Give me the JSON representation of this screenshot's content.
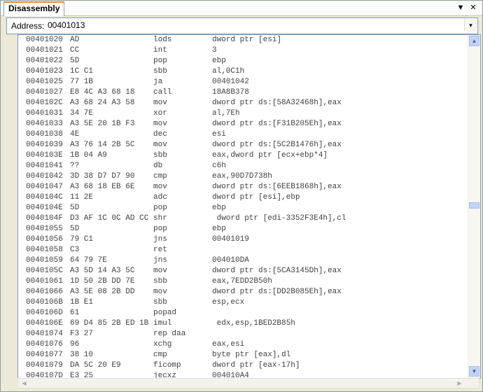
{
  "window": {
    "tab_title": "Disassembly",
    "dropdown_glyph": "▼",
    "close_glyph": "✕"
  },
  "address": {
    "label": "Address:",
    "value": "00401013",
    "dropdown_glyph": "▾"
  },
  "scroll": {
    "up_glyph": "▲",
    "down_glyph": "▼",
    "left_glyph": "◀",
    "right_glyph": "▶"
  },
  "lines": [
    {
      "addr": "00401020",
      "bytes": "AD",
      "mnem": "lods",
      "ops": "dword ptr [esi]"
    },
    {
      "addr": "00401021",
      "bytes": "CC",
      "mnem": "int",
      "ops": "3"
    },
    {
      "addr": "00401022",
      "bytes": "5D",
      "mnem": "pop",
      "ops": "ebp"
    },
    {
      "addr": "00401023",
      "bytes": "1C C1",
      "mnem": "sbb",
      "ops": "al,0C1h"
    },
    {
      "addr": "00401025",
      "bytes": "77 1B",
      "mnem": "ja",
      "ops": "00401042"
    },
    {
      "addr": "00401027",
      "bytes": "E8 4C A3 68 18",
      "mnem": "call",
      "ops": "18A8B378"
    },
    {
      "addr": "0040102C",
      "bytes": "A3 68 24 A3 58",
      "mnem": "mov",
      "ops": "dword ptr ds:[58A32468h],eax"
    },
    {
      "addr": "00401031",
      "bytes": "34 7E",
      "mnem": "xor",
      "ops": "al,7Eh"
    },
    {
      "addr": "00401033",
      "bytes": "A3 5E 20 1B F3",
      "mnem": "mov",
      "ops": "dword ptr ds:[F31B205Eh],eax"
    },
    {
      "addr": "00401038",
      "bytes": "4E",
      "mnem": "dec",
      "ops": "esi"
    },
    {
      "addr": "00401039",
      "bytes": "A3 76 14 2B 5C",
      "mnem": "mov",
      "ops": "dword ptr ds:[5C2B1476h],eax"
    },
    {
      "addr": "0040103E",
      "bytes": "1B 04 A9",
      "mnem": "sbb",
      "ops": "eax,dword ptr [ecx+ebp*4]"
    },
    {
      "addr": "00401041",
      "bytes": "??",
      "mnem": "db",
      "ops": "c6h"
    },
    {
      "addr": "00401042",
      "bytes": "3D 38 D7 D7 90",
      "mnem": "cmp",
      "ops": "eax,90D7D738h"
    },
    {
      "addr": "00401047",
      "bytes": "A3 68 18 EB 6E",
      "mnem": "mov",
      "ops": "dword ptr ds:[6EEB1868h],eax"
    },
    {
      "addr": "0040104C",
      "bytes": "11 2E",
      "mnem": "adc",
      "ops": "dword ptr [esi],ebp"
    },
    {
      "addr": "0040104E",
      "bytes": "5D",
      "mnem": "pop",
      "ops": "ebp"
    },
    {
      "addr": "0040104F",
      "bytes": "D3 AF 1C 0C AD CC",
      "mnem": "shr",
      "ops": " dword ptr [edi-3352F3E4h],cl"
    },
    {
      "addr": "00401055",
      "bytes": "5D",
      "mnem": "pop",
      "ops": "ebp"
    },
    {
      "addr": "00401056",
      "bytes": "79 C1",
      "mnem": "jns",
      "ops": "00401019"
    },
    {
      "addr": "00401058",
      "bytes": "C3",
      "mnem": "ret",
      "ops": ""
    },
    {
      "addr": "00401059",
      "bytes": "64 79 7E",
      "mnem": "jns",
      "ops": "004010DA"
    },
    {
      "addr": "0040105C",
      "bytes": "A3 5D 14 A3 5C",
      "mnem": "mov",
      "ops": "dword ptr ds:[5CA3145Dh],eax"
    },
    {
      "addr": "00401061",
      "bytes": "1D 50 2B DD 7E",
      "mnem": "sbb",
      "ops": "eax,7EDD2B50h"
    },
    {
      "addr": "00401066",
      "bytes": "A3 5E 08 2B DD",
      "mnem": "mov",
      "ops": "dword ptr ds:[DD2B085Eh],eax"
    },
    {
      "addr": "0040106B",
      "bytes": "1B E1",
      "mnem": "sbb",
      "ops": "esp,ecx"
    },
    {
      "addr": "0040106D",
      "bytes": "61",
      "mnem": "popad",
      "ops": ""
    },
    {
      "addr": "0040106E",
      "bytes": "69 D4 85 2B ED 1B",
      "mnem": "imul",
      "ops": " edx,esp,1BED2B85h"
    },
    {
      "addr": "00401074",
      "bytes": "F3 27",
      "mnem": "rep daa",
      "ops": ""
    },
    {
      "addr": "00401076",
      "bytes": "96",
      "mnem": "xchg",
      "ops": "eax,esi"
    },
    {
      "addr": "00401077",
      "bytes": "38 10",
      "mnem": "cmp",
      "ops": "byte ptr [eax],dl"
    },
    {
      "addr": "00401079",
      "bytes": "DA 5C 20 E9",
      "mnem": "ficomp",
      "ops": "dword ptr [eax-17h]"
    },
    {
      "addr": "0040107D",
      "bytes": "E3 25",
      "mnem": "jecxz",
      "ops": "004010A4"
    }
  ]
}
